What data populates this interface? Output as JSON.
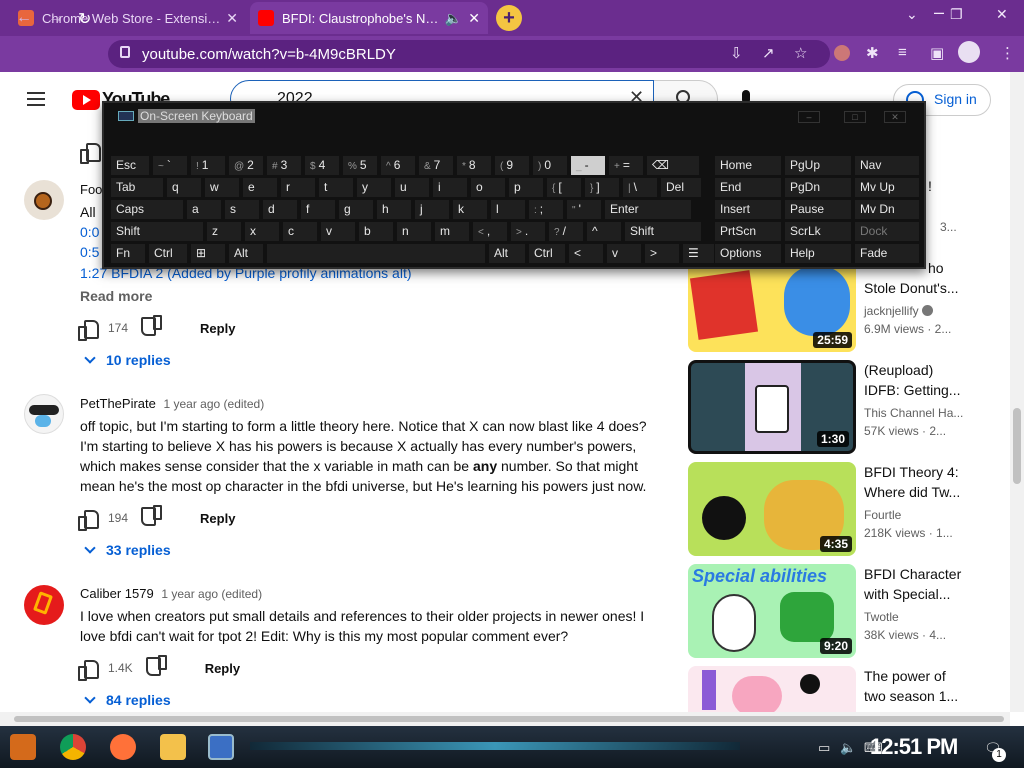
{
  "browser": {
    "tabs": [
      {
        "title": "Chrome Web Store - Extensions",
        "icon": "chrome-store-icon"
      },
      {
        "title": "BFDI: Claustrophobe's Night",
        "icon": "youtube-icon",
        "audio": "speaker-icon"
      }
    ],
    "new_tab": "+",
    "url": "youtube.com/watch?v=b-4M9cBRLDY"
  },
  "youtube": {
    "logo": "YouTube",
    "search_value": "2022",
    "sign_in": "Sign in"
  },
  "comments": {
    "first": {
      "author_partial": "Foo",
      "lines": [
        "All",
        "0:0",
        "0:5",
        "1:27 BFDIA 2 (Added by Purple profily animations alt)"
      ],
      "read_more": "Read more",
      "likes": "174",
      "reply": "Reply",
      "replies": "10 replies"
    },
    "second": {
      "author": "PetThePirate",
      "time": "1 year ago (edited)",
      "text_before": "off topic, but I'm starting to form a little theory here. Notice that X can now blast like 4 does? I'm starting to believe X has his powers is because X actually has every number's powers, which makes sense consider that the x variable in math can be ",
      "text_bold": "any",
      "text_after": " number. So that might mean he's the most op character in the bfdi universe, but He's learning his powers just now.",
      "likes": "194",
      "reply": "Reply",
      "replies": "33 replies"
    },
    "third": {
      "author": "Caliber 1579",
      "time": "1 year ago (edited)",
      "text": "I love when creators put small details and references to their older projects in newer ones! I love bfdi can't wait for tpot 2! Edit: Why is this my most popular comment ever?",
      "likes": "1.4K",
      "reply": "Reply",
      "replies": "84 replies"
    }
  },
  "sidebar": {
    "top_fragments": [
      "ho",
      "!",
      "3..."
    ],
    "videos": [
      {
        "title": "Stole Donut's...",
        "channel": "jacknjellify",
        "views": "6.9M views · 2...",
        "duration": "25:59"
      },
      {
        "title": "(Reupload) IDFB: Getting...",
        "channel": "This Channel Ha...",
        "views": "57K views · 2...",
        "duration": "1:30"
      },
      {
        "title": "BFDI Theory 4: Where did Tw...",
        "channel": "Fourtle",
        "views": "218K views · 1...",
        "duration": "4:35"
      },
      {
        "title": "BFDI Character with Special...",
        "channel": "Twotle",
        "views": "38K views · 4...",
        "duration": "9:20",
        "thumb_text": "Special abilities"
      },
      {
        "title": "The power of two season 1...",
        "channel": "",
        "views": "",
        "duration": ""
      }
    ]
  },
  "osk": {
    "title": "On-Screen Keyboard",
    "row1": [
      {
        "label": "Esc"
      },
      {
        "shift": "~",
        "label": "`"
      },
      {
        "shift": "!",
        "label": "1"
      },
      {
        "shift": "@",
        "label": "2"
      },
      {
        "shift": "#",
        "label": "3"
      },
      {
        "shift": "$",
        "label": "4"
      },
      {
        "shift": "%",
        "label": "5"
      },
      {
        "shift": "^",
        "label": "6"
      },
      {
        "shift": "&",
        "label": "7"
      },
      {
        "shift": "*",
        "label": "8"
      },
      {
        "shift": "(",
        "label": "9"
      },
      {
        "shift": ")",
        "label": "0"
      },
      {
        "shift": "_",
        "label": "-"
      },
      {
        "shift": "+",
        "label": "="
      },
      {
        "label": "⌫"
      }
    ],
    "row2": [
      {
        "label": "Tab"
      },
      {
        "label": "q"
      },
      {
        "label": "w"
      },
      {
        "label": "e"
      },
      {
        "label": "r"
      },
      {
        "label": "t"
      },
      {
        "label": "y"
      },
      {
        "label": "u"
      },
      {
        "label": "i"
      },
      {
        "label": "o"
      },
      {
        "label": "p"
      },
      {
        "shift": "{",
        "label": "["
      },
      {
        "shift": "}",
        "label": "]"
      },
      {
        "shift": "|",
        "label": "\\"
      },
      {
        "label": "Del"
      }
    ],
    "row3": [
      {
        "label": "Caps"
      },
      {
        "label": "a"
      },
      {
        "label": "s"
      },
      {
        "label": "d"
      },
      {
        "label": "f"
      },
      {
        "label": "g"
      },
      {
        "label": "h"
      },
      {
        "label": "j"
      },
      {
        "label": "k"
      },
      {
        "label": "l"
      },
      {
        "shift": ":",
        "label": ";"
      },
      {
        "shift": "\"",
        "label": "'"
      },
      {
        "label": "Enter"
      }
    ],
    "row4": [
      {
        "label": "Shift"
      },
      {
        "label": "z"
      },
      {
        "label": "x"
      },
      {
        "label": "c"
      },
      {
        "label": "v"
      },
      {
        "label": "b"
      },
      {
        "label": "n"
      },
      {
        "label": "m"
      },
      {
        "shift": "<",
        "label": ","
      },
      {
        "shift": ">",
        "label": "."
      },
      {
        "shift": "?",
        "label": "/"
      },
      {
        "label": "^"
      },
      {
        "label": "Shift"
      }
    ],
    "row5": [
      {
        "label": "Fn"
      },
      {
        "label": "Ctrl"
      },
      {
        "label": "⊞"
      },
      {
        "label": "Alt"
      },
      {
        "label": ""
      },
      {
        "label": "Alt"
      },
      {
        "label": "Ctrl"
      },
      {
        "label": "<"
      },
      {
        "label": "v"
      },
      {
        "label": ">"
      },
      {
        "label": "☰"
      }
    ],
    "nav": [
      [
        "Home",
        "PgUp",
        "Nav"
      ],
      [
        "End",
        "PgDn",
        "Mv Up"
      ],
      [
        "Insert",
        "Pause",
        "Mv Dn"
      ],
      [
        "PrtScn",
        "ScrLk",
        "Dock"
      ],
      [
        "Options",
        "Help",
        "Fade"
      ]
    ]
  },
  "taskbar": {
    "clock": "12:51 PM",
    "notification_count": "1"
  }
}
